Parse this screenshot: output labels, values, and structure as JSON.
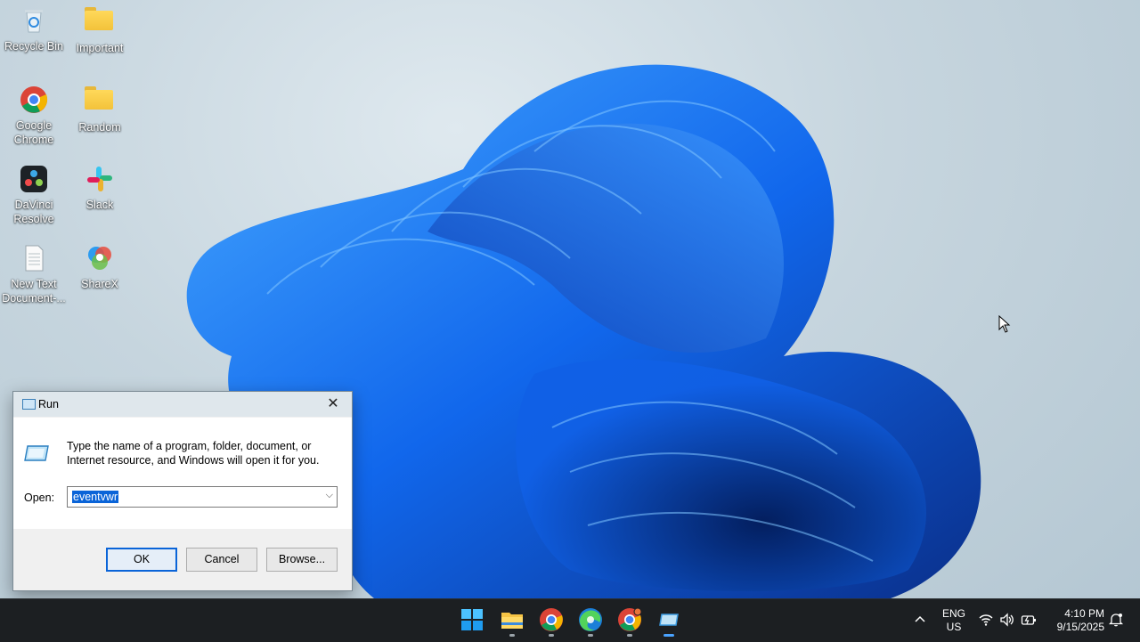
{
  "desktop": {
    "icons": [
      {
        "label": "Recycle Bin",
        "icon": "recycle-bin-icon"
      },
      {
        "label": "Important",
        "icon": "folder-icon"
      },
      {
        "label": "Google Chrome",
        "icon": "chrome-icon"
      },
      {
        "label": "Random",
        "icon": "folder-icon"
      },
      {
        "label": "DaVinci Resolve",
        "icon": "davinci-resolve-icon"
      },
      {
        "label": "Slack",
        "icon": "slack-icon"
      },
      {
        "label": "New Text Document-...",
        "icon": "text-document-icon"
      },
      {
        "label": "ShareX",
        "icon": "sharex-icon"
      }
    ]
  },
  "run_dialog": {
    "title": "Run",
    "description": "Type the name of a program, folder, document, or Internet resource, and Windows will open it for you.",
    "open_label": "Open:",
    "open_value": "eventvwr",
    "ok_label": "OK",
    "cancel_label": "Cancel",
    "browse_label": "Browse..."
  },
  "taskbar": {
    "apps": [
      "start-icon",
      "file-explorer-icon",
      "chrome-icon",
      "edge-icon",
      "chrome-icon",
      "run-icon"
    ],
    "language": "ENG",
    "region": "US",
    "time": "4:10 PM",
    "date": "9/15/2025"
  },
  "colors": {
    "selection": "#0a64d8",
    "taskbar": "#1c1f22",
    "bloom": "#1565e8"
  }
}
